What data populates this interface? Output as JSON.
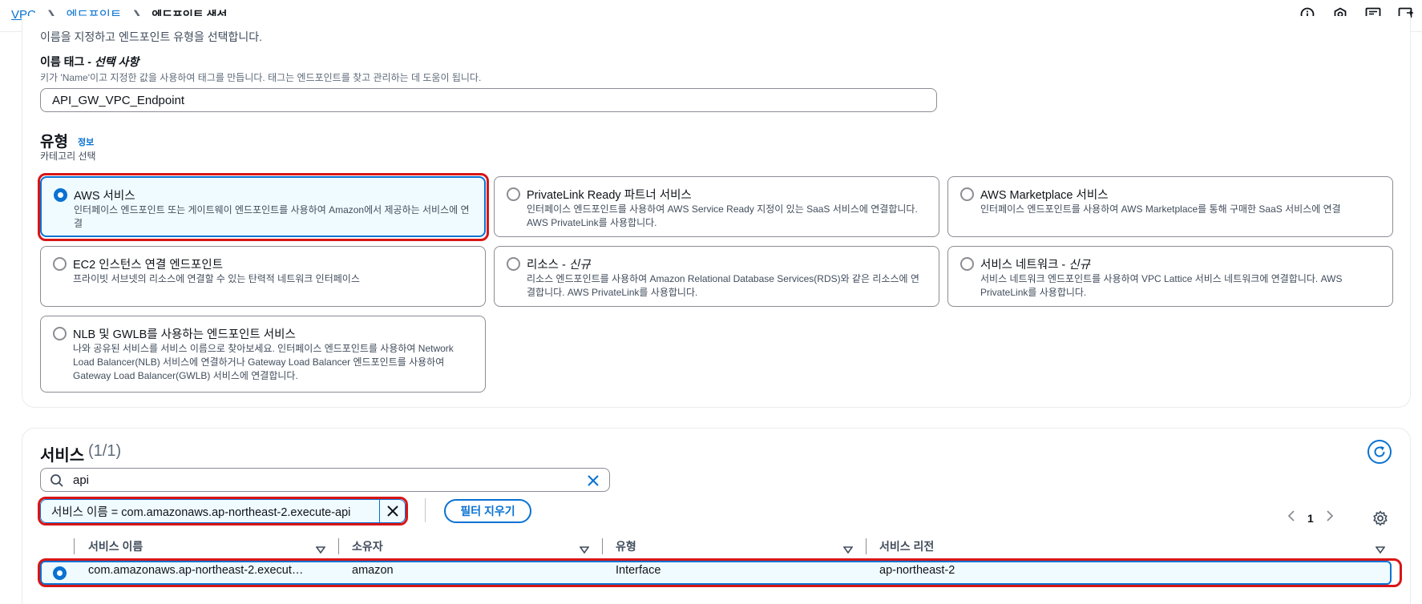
{
  "breadcrumb": {
    "items": [
      "VPC",
      "엔드포인트"
    ],
    "current": "엔드포인트 생성"
  },
  "header": {
    "icons": [
      "info-icon",
      "settings-hex-icon",
      "feedback-icon",
      "exit-icon"
    ]
  },
  "intro_text": "이름을 지정하고 엔드포인트 유형을 선택합니다.",
  "name_tag": {
    "label": "이름 태그 - ",
    "optional": "선택 사항",
    "description": "키가 'Name'이고 지정한 값을 사용하여 태그를 만듭니다. 태그는 엔드포인트를 찾고 관리하는 데 도움이 됩니다.",
    "value": "API_GW_VPC_Endpoint"
  },
  "type_section": {
    "title": "유형",
    "info": "정보",
    "subtitle": "카테고리 선택",
    "tiles": [
      {
        "title": "AWS 서비스",
        "suffix": "",
        "desc": "인터페이스 엔드포인트 또는 게이트웨이 엔드포인트를 사용하여 Amazon에서 제공하는 서비스에 연결",
        "selected": true
      },
      {
        "title": "PrivateLink Ready 파트너 서비스",
        "suffix": "",
        "desc": "인터페이스 엔드포인트를 사용하여 AWS Service Ready 지정이 있는 SaaS 서비스에 연결합니다. AWS PrivateLink를 사용합니다.",
        "selected": false
      },
      {
        "title": "AWS Marketplace 서비스",
        "suffix": "",
        "desc": "인터페이스 엔드포인트를 사용하여 AWS Marketplace를 통해 구매한 SaaS 서비스에 연결",
        "selected": false
      },
      {
        "title": "EC2 인스턴스 연결 엔드포인트",
        "suffix": "",
        "desc": "프라이빗 서브넷의 리소스에 연결할 수 있는 탄력적 네트워크 인터페이스",
        "selected": false
      },
      {
        "title": "리소스 - ",
        "suffix": "신규",
        "desc": "리소스 엔드포인트를 사용하여 Amazon Relational Database Services(RDS)와 같은 리소스에 연결합니다. AWS PrivateLink를 사용합니다.",
        "selected": false
      },
      {
        "title": "서비스 네트워크 - ",
        "suffix": "신규",
        "desc": "서비스 네트워크 엔드포인트를 사용하여 VPC Lattice 서비스 네트워크에 연결합니다. AWS PrivateLink를 사용합니다.",
        "selected": false
      },
      {
        "title": "NLB 및 GWLB를 사용하는 엔드포인트 서비스",
        "suffix": "",
        "desc": "나와 공유된 서비스를 서비스 이름으로 찾아보세요. 인터페이스 엔드포인트를 사용하여 Network Load Balancer(NLB) 서비스에 연결하거나 Gateway Load Balancer 엔드포인트를 사용하여 Gateway Load Balancer(GWLB) 서비스에 연결합니다.",
        "selected": false
      }
    ]
  },
  "services": {
    "title": "서비스",
    "count": "(1/1)",
    "search_value": "api",
    "filter_token": "서비스 이름 = com.amazonaws.ap-northeast-2.execute-api",
    "clear_filters": "필터 지우기",
    "page": "1",
    "columns": [
      "서비스 이름",
      "소유자",
      "유형",
      "서비스 리전"
    ],
    "rows": [
      {
        "name": "com.amazonaws.ap-northeast-2.execut…",
        "owner": "amazon",
        "type": "Interface",
        "region": "ap-northeast-2",
        "selected": true
      }
    ]
  },
  "colors": {
    "accent": "#0972d3",
    "highlight_ring": "#d91515",
    "selected_bg": "#f0fbff"
  }
}
